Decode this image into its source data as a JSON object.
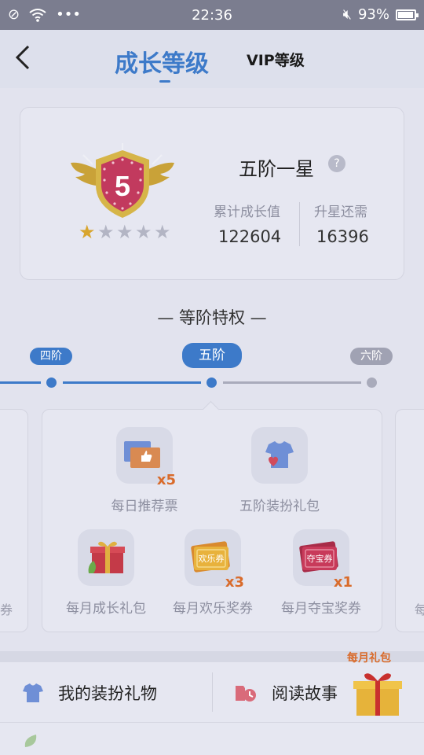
{
  "status_bar": {
    "time": "22:36",
    "battery": "93%"
  },
  "nav": {
    "back_icon": "chevron-left-icon",
    "tab_growth": "成长等级",
    "tab_vip": "VIP等级"
  },
  "level": {
    "name": "五阶一星",
    "badge_number": "5",
    "stars_filled": 1,
    "stars_total": 5,
    "growth_label": "累计成长值",
    "growth_value": "122604",
    "upgrade_label": "升星还需",
    "upgrade_value": "16396"
  },
  "privileges": {
    "title": "— 等阶特权 —",
    "timeline": {
      "prev": "四阶",
      "current": "五阶",
      "next": "六阶"
    },
    "items": [
      {
        "label": "每日推荐票",
        "multiplier": "x5",
        "icon": "ticket-icon"
      },
      {
        "label": "五阶装扮礼包",
        "multiplier": "",
        "icon": "tshirt-icon"
      },
      {
        "label": "每月成长礼包",
        "multiplier": "",
        "icon": "gift-box-icon"
      },
      {
        "label": "每月欢乐奖券",
        "multiplier": "x3",
        "icon": "coupon-icon",
        "coupon_text": "欢乐券"
      },
      {
        "label": "每月夺宝奖券",
        "multiplier": "x1",
        "icon": "coupon-icon",
        "coupon_text": "夺宝券"
      }
    ],
    "left_partial": "券",
    "right_partial": "每"
  },
  "menu": {
    "my_dress_gifts": "我的装扮礼物",
    "read_stories": "阅读故事",
    "monthly_gift": "每月礼包"
  },
  "colors": {
    "accent": "#3d7ac9",
    "orange": "#d96b2b"
  }
}
